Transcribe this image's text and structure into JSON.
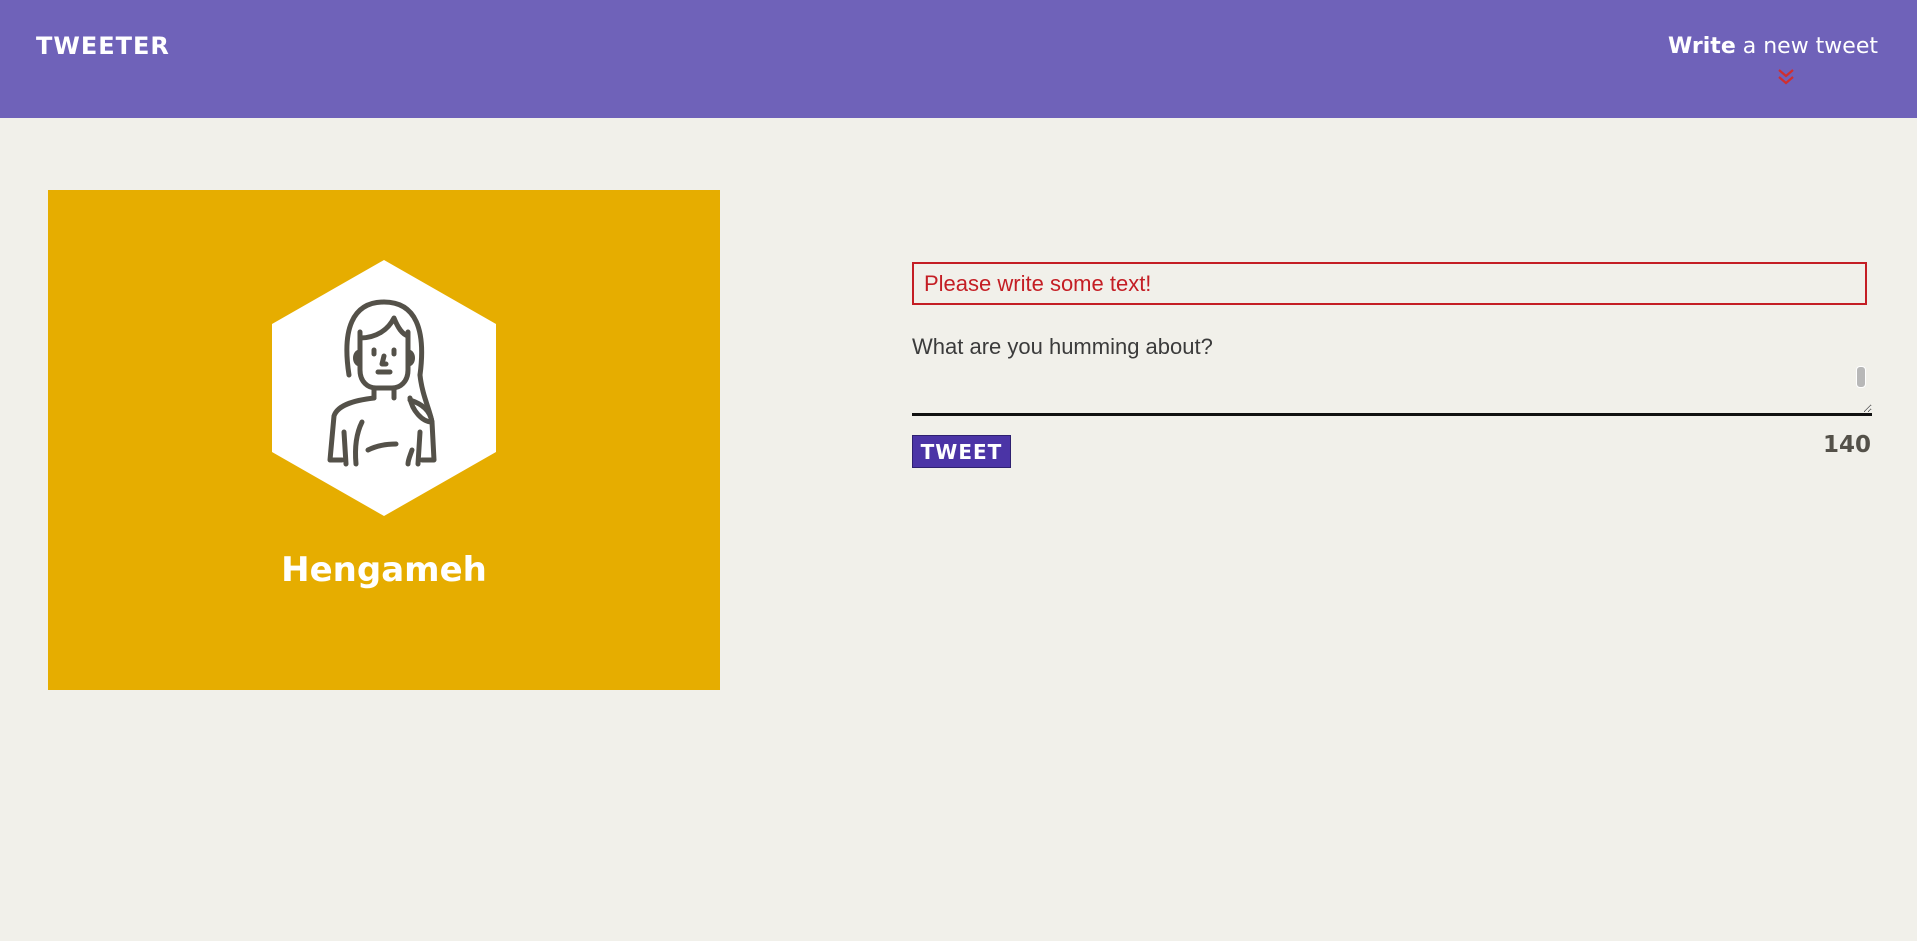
{
  "nav": {
    "brand": "TWEETER",
    "compose_strong": "Write",
    "compose_rest": " a new tweet",
    "toggle_icon": "double-chevron-down-icon",
    "background": "#6f62b9",
    "icon_color": "#d12f2f"
  },
  "profile": {
    "name": "Hengameh",
    "avatar_icon": "woman-avatar-icon",
    "background": "#e6ad00"
  },
  "composer": {
    "error_message": "Please write some text!",
    "placeholder": "What are you humming about?",
    "value": "",
    "button_label": "TWEET",
    "char_count": "140",
    "button_color": "#4b34a6",
    "error_color": "#c41e24"
  }
}
